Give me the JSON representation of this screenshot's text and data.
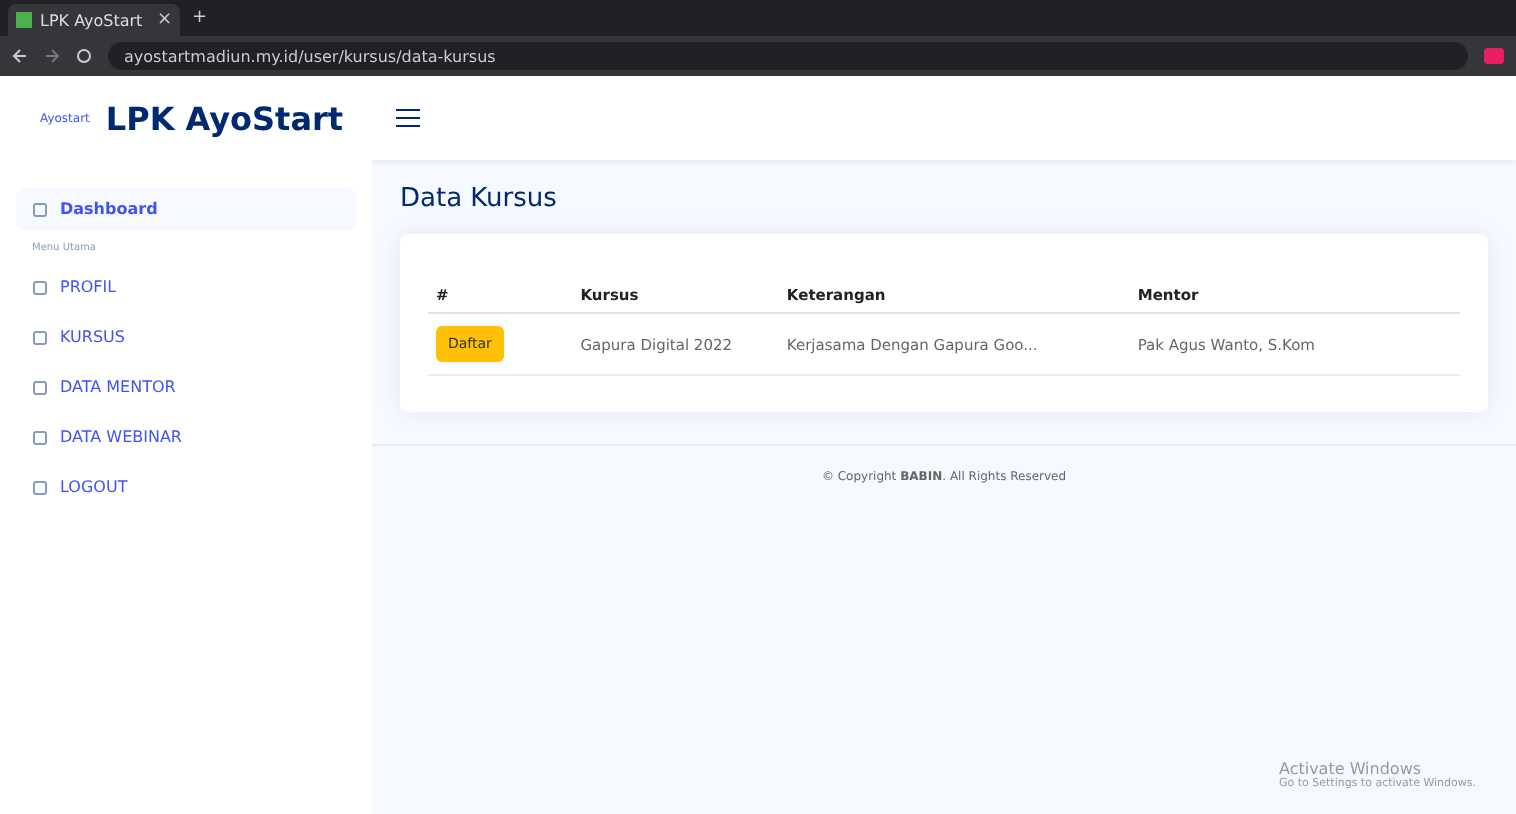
{
  "browser": {
    "tab_title": "LPK AyoStart",
    "tab_close": "×",
    "new_tab": "+",
    "url": "ayostartmadiun.my.id/user/kursus/data-kursus"
  },
  "header": {
    "logo_small": "Ayostart",
    "logo": "LPK AyoStart"
  },
  "sidebar": {
    "items": [
      {
        "label": "Dashboard",
        "selected": true
      },
      {
        "kind": "heading",
        "label": "Menu Utama"
      },
      {
        "label": "PROFIL",
        "selected": false
      },
      {
        "label": "KURSUS",
        "selected": false
      },
      {
        "label": "DATA MENTOR",
        "selected": false
      },
      {
        "label": "DATA WEBINAR",
        "selected": false
      },
      {
        "label": "LOGOUT",
        "selected": false
      }
    ]
  },
  "page_title": "Data Kursus",
  "table": {
    "columns": [
      "#",
      "Kursus",
      "Keterangan",
      "Mentor"
    ],
    "rows": [
      {
        "cells": [
          {
            "kind": "button",
            "text": "Daftar"
          },
          {
            "kind": "text",
            "text": "Gapura Digital 2022"
          },
          {
            "kind": "text",
            "text": "Kerjasama Dengan Gapura Goo..."
          },
          {
            "kind": "text",
            "text": "Pak Agus Wanto, S.Kom"
          }
        ]
      }
    ]
  },
  "footer": "© Copyright **BABIN**. All Rights Reserved",
  "os_notice": {
    "title": "Activate Windows",
    "text": "Go to Settings to activate Windows."
  }
}
